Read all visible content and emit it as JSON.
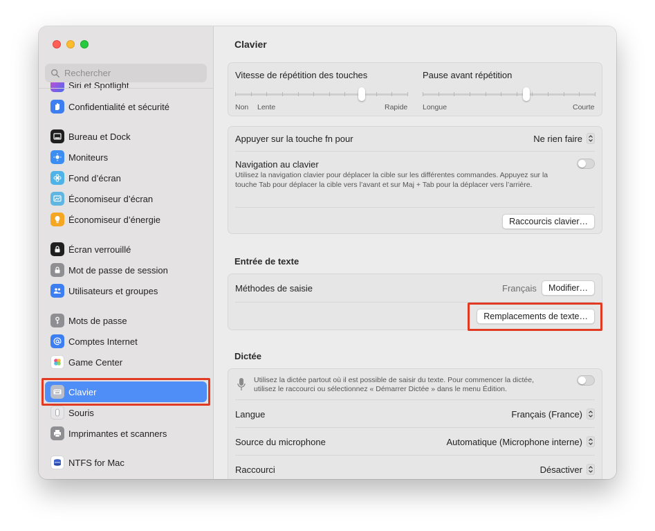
{
  "colors": {
    "accent": "#4f8ef7",
    "highlight": "#e03a22"
  },
  "search": {
    "placeholder": "Rechercher"
  },
  "sidebar": {
    "items": [
      {
        "label": "Siri et Spotlight",
        "icon": "siri-icon",
        "color": "#8e5bd6"
      },
      {
        "label": "Confidentialité et sécurité",
        "icon": "hand-icon",
        "color": "#3d7ff0"
      },
      {
        "label": "Bureau et Dock",
        "icon": "dock-icon",
        "color": "#1f1f1f"
      },
      {
        "label": "Moniteurs",
        "icon": "sun-icon",
        "color": "#3d8ef2"
      },
      {
        "label": "Fond d’écran",
        "icon": "flower-icon",
        "color": "#4fb3e8"
      },
      {
        "label": "Économiseur d’écran",
        "icon": "screensaver-icon",
        "color": "#5fb6e0"
      },
      {
        "label": "Économiseur d’énergie",
        "icon": "bulb-icon",
        "color": "#f5a623"
      },
      {
        "label": "Écran verrouillé",
        "icon": "lock-screen-icon",
        "color": "#1f1f1f"
      },
      {
        "label": "Mot de passe de session",
        "icon": "lock-icon",
        "color": "#8e8e93"
      },
      {
        "label": "Utilisateurs et groupes",
        "icon": "users-icon",
        "color": "#3d7ff0"
      },
      {
        "label": "Mots de passe",
        "icon": "key-icon",
        "color": "#8e8e93"
      },
      {
        "label": "Comptes Internet",
        "icon": "at-icon",
        "color": "#3d7ff0"
      },
      {
        "label": "Game Center",
        "icon": "game-center-icon",
        "color": "#ffffff"
      },
      {
        "label": "Clavier",
        "icon": "keyboard-icon",
        "color": "#8e8e93"
      },
      {
        "label": "Souris",
        "icon": "mouse-icon",
        "color": "#8e8e93"
      },
      {
        "label": "Imprimantes et scanners",
        "icon": "printer-icon",
        "color": "#8e8e93"
      },
      {
        "label": "NTFS for Mac",
        "icon": "ntfs-icon",
        "color": "#3d5fc9"
      }
    ]
  },
  "main": {
    "title": "Clavier",
    "repeat": {
      "speed_label": "Vitesse de répétition des touches",
      "speed_min": "Non",
      "speed_low": "Lente",
      "speed_max": "Rapide",
      "speed_value": 0.73,
      "delay_label": "Pause avant répétition",
      "delay_min": "Longue",
      "delay_max": "Courte",
      "delay_value": 0.6
    },
    "fn": {
      "label": "Appuyer sur la touche fn pour",
      "value": "Ne rien faire"
    },
    "nav": {
      "label": "Navigation au clavier",
      "description": "Utilisez la navigation clavier pour déplacer la cible sur les différentes commandes. Appuyez sur la touche Tab pour déplacer la cible vers l’avant et sur Maj + Tab pour la déplacer vers l’arrière.",
      "enabled": false
    },
    "shortcuts_button": "Raccourcis clavier…",
    "text_input": {
      "title": "Entrée de texte",
      "methods_label": "Méthodes de saisie",
      "methods_value": "Français",
      "modify_button": "Modifier…",
      "replacements_button": "Remplacements de texte…"
    },
    "dictation": {
      "title": "Dictée",
      "description": "Utilisez la dictée partout où il est possible de saisir du texte. Pour commencer la dictée, utilisez le raccourci ou sélectionnez « Démarrer Dictée » dans le menu Édition.",
      "enabled": false,
      "language_label": "Langue",
      "language_value": "Français (France)",
      "mic_label": "Source du microphone",
      "mic_value": "Automatique (Microphone interne)",
      "shortcut_label": "Raccourci",
      "shortcut_value": "Désactiver"
    }
  }
}
